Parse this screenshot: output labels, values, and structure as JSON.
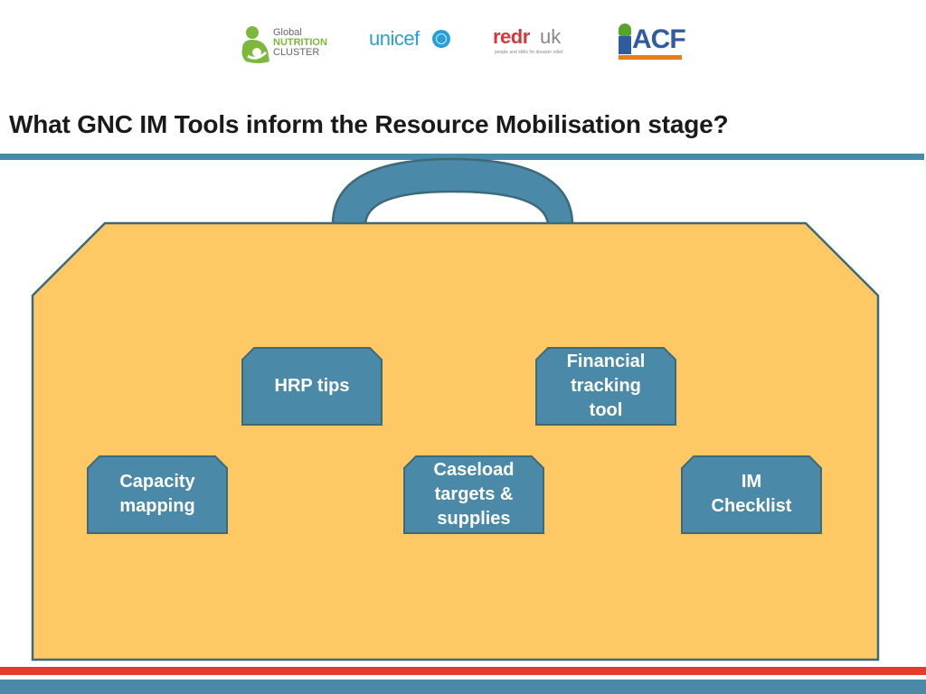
{
  "logos": {
    "gnc": {
      "line1": "Global",
      "line2": "NUTRITION",
      "line3": "CLUSTER"
    },
    "unicef": {
      "name": "unicef"
    },
    "redr": {
      "name_bold": "redr",
      "name_light": "uk",
      "tagline": "people and skills for disaster relief"
    },
    "acf": {
      "name": "ACF"
    }
  },
  "header": {
    "title": "What GNC IM Tools inform the Resource Mobilisation stage?"
  },
  "diagram": {
    "container": "briefcase",
    "colors": {
      "bag_fill": "#fec965",
      "bag_stroke": "#3d6a78",
      "handle_fill": "#4a8aa8",
      "box_fill": "#4a8aa8",
      "box_text": "#ffffff"
    },
    "tools": [
      {
        "id": "hrp-tips",
        "label": "HRP tips"
      },
      {
        "id": "financial-tracking-tool",
        "label": "Financial\ntracking\ntool"
      },
      {
        "id": "capacity-mapping",
        "label": "Capacity\nmapping"
      },
      {
        "id": "caseload-targets-supplies",
        "label": "Caseload\ntargets &\nsupplies"
      },
      {
        "id": "im-checklist",
        "label": "IM\nChecklist"
      }
    ]
  },
  "footer": {
    "stripe_colors": [
      "#e8392e",
      "#4a8aa8"
    ]
  }
}
